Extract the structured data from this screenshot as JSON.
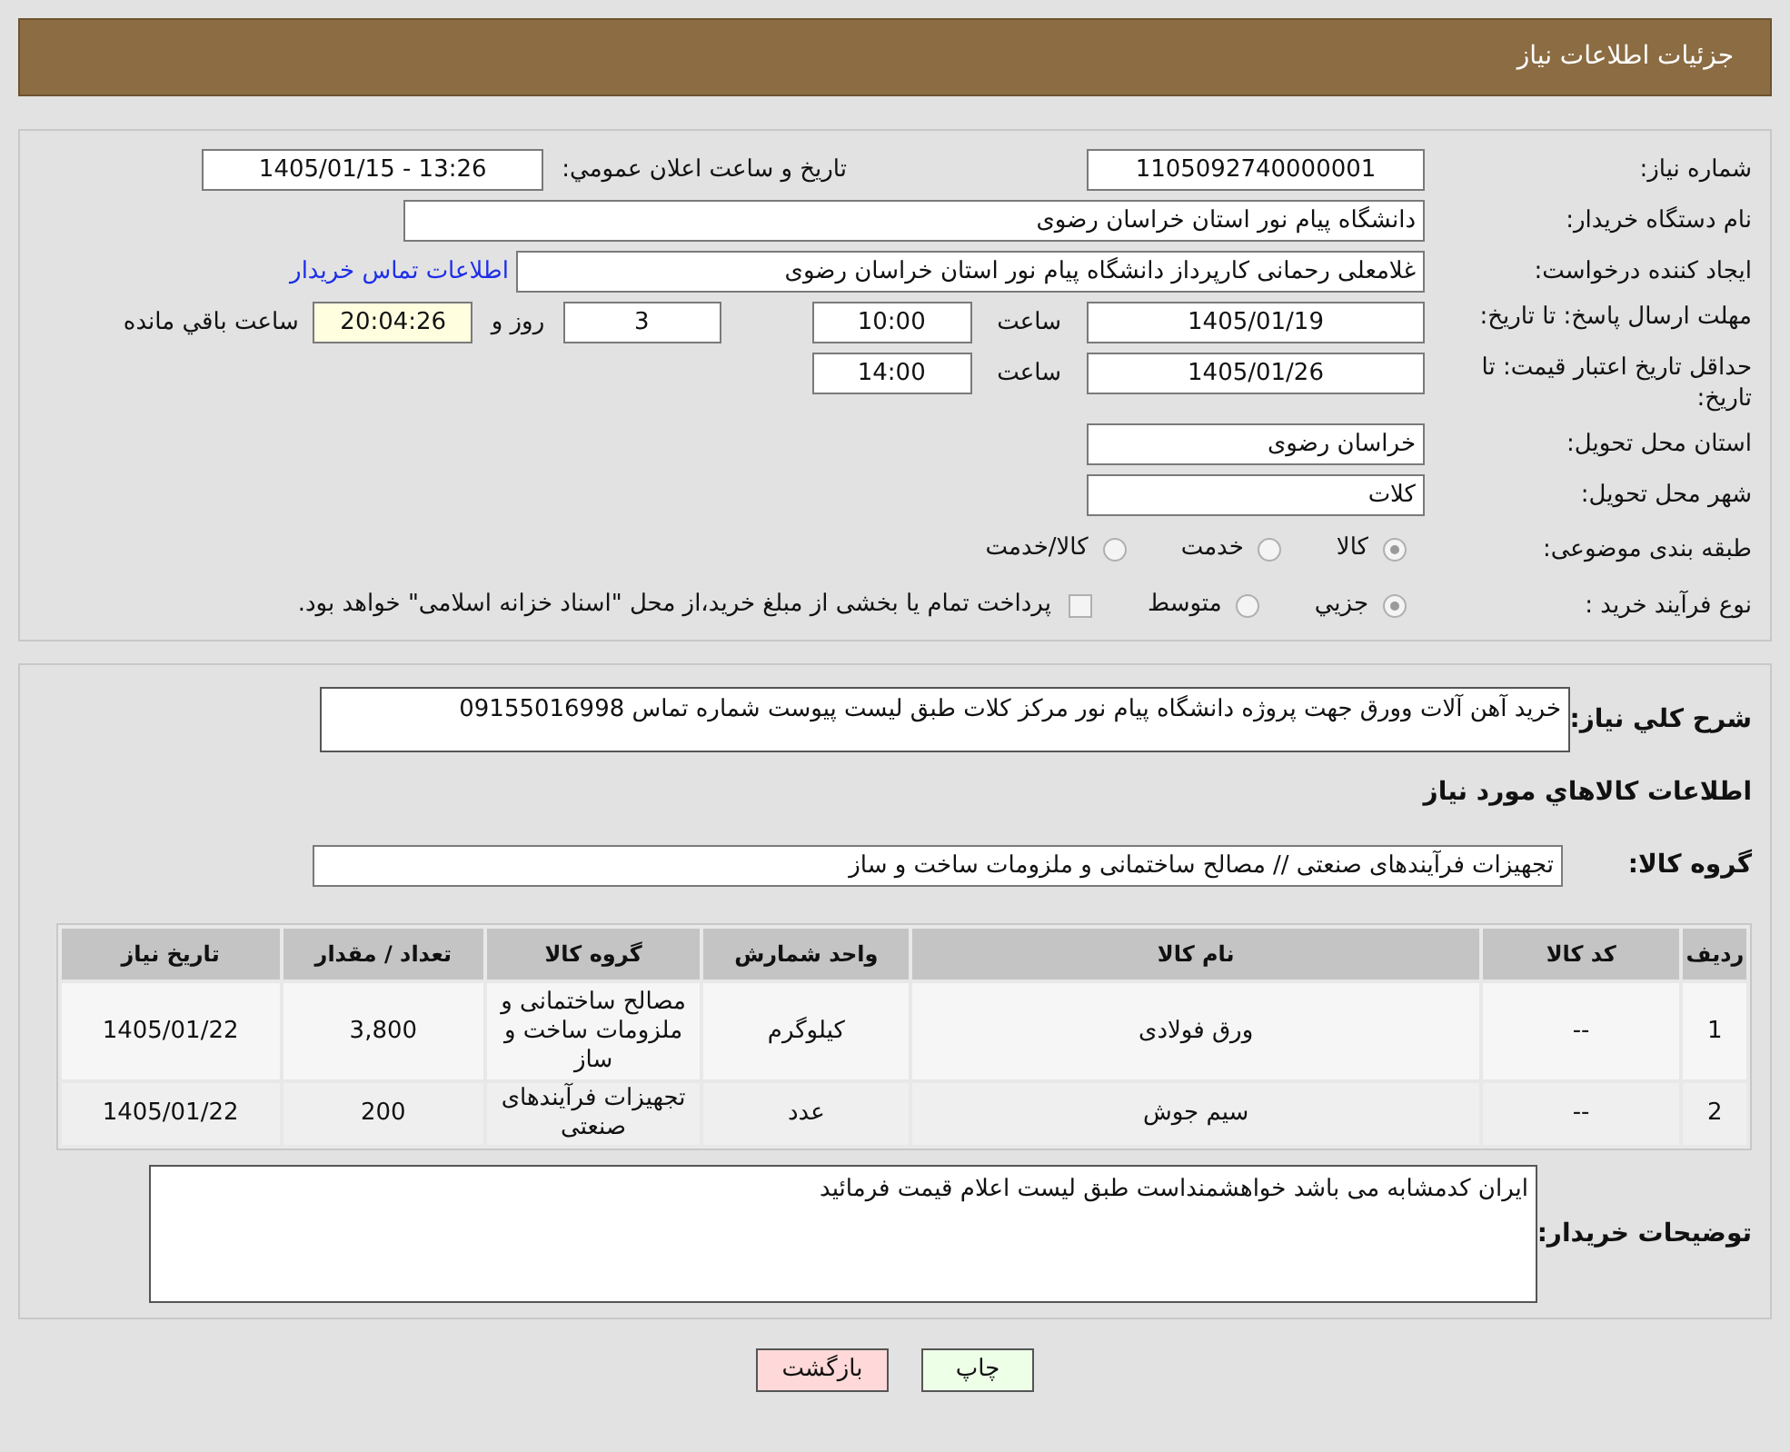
{
  "header": {
    "title": "جزئیات اطلاعات نیاز"
  },
  "need_number": {
    "label": "شماره نیاز:",
    "value": "1105092740000001"
  },
  "announce": {
    "label": "تاریخ و ساعت اعلان عمومي:",
    "value": "1405/01/15 - 13:26"
  },
  "buyer": {
    "label": "نام دستگاه خریدار:",
    "value": "دانشگاه پیام نور استان خراسان رضوی"
  },
  "requester": {
    "label": "ایجاد کننده درخواست:",
    "value": "غلامعلی رحمانی کارپرداز دانشگاه پیام نور استان خراسان رضوی",
    "link": "اطلاعات تماس خریدار"
  },
  "deadline": {
    "label": "مهلت ارسال پاسخ: تا تاریخ:",
    "date": "1405/01/19",
    "time_label": "ساعت",
    "time": "10:00",
    "days": "3",
    "days_label": "روز و",
    "remaining": "20:04:26",
    "remaining_label": "ساعت باقي مانده"
  },
  "validity": {
    "label": "حداقل تاریخ اعتبار قیمت: تا تاریخ:",
    "date": "1405/01/26",
    "time_label": "ساعت",
    "time": "14:00"
  },
  "province": {
    "label": "استان محل تحویل:",
    "value": "خراسان رضوی"
  },
  "city": {
    "label": "شهر محل تحویل:",
    "value": "کلات"
  },
  "category": {
    "label": "طبقه بندی موضوعی:",
    "options": [
      {
        "label": "کالا",
        "selected": true
      },
      {
        "label": "خدمت",
        "selected": false
      },
      {
        "label": "کالا/خدمت",
        "selected": false
      }
    ]
  },
  "purchase_type": {
    "label": "نوع فرآیند خرید :",
    "options": [
      {
        "label": "جزیي",
        "selected": true
      },
      {
        "label": "متوسط",
        "selected": false
      }
    ],
    "treasury": {
      "label": "پرداخت تمام یا بخشی از مبلغ خرید،از محل \"اسناد خزانه اسلامی\" خواهد بود.",
      "checked": false
    }
  },
  "description": {
    "label": "شرح کلي نیاز:",
    "value": "خرید آهن آلات وورق جهت پروژه دانشگاه پیام نور مرکز کلات طبق لیست پیوست شماره تماس 09155016998"
  },
  "goods_title": "اطلاعات کالاهاي مورد نیاز",
  "goods_group": {
    "label": "گروه کالا:",
    "value": "تجهیزات فرآیندهای صنعتی // مصالح ساختمانی و ملزومات ساخت و ساز"
  },
  "table": {
    "columns": [
      "ردیف",
      "کد کالا",
      "نام کالا",
      "واحد شمارش",
      "گروه کالا",
      "تعداد / مقدار",
      "تاریخ نیاز"
    ],
    "rows": [
      [
        "1",
        "--",
        "ورق فولادی",
        "کیلوگرم",
        "مصالح ساختمانی و ملزومات ساخت و ساز",
        "3,800",
        "1405/01/22"
      ],
      [
        "2",
        "--",
        "سیم جوش",
        "عدد",
        "تجهیزات فرآیندهای صنعتی",
        "200",
        "1405/01/22"
      ]
    ]
  },
  "buyer_notes": {
    "label": "توضیحات خریدار:",
    "value": "ایران کدمشابه می باشد خواهشمنداست طبق لیست اعلام قیمت فرمائید"
  },
  "buttons": [
    {
      "label": "چاپ",
      "kind": "print"
    },
    {
      "label": "بازگشت",
      "kind": "back"
    }
  ]
}
